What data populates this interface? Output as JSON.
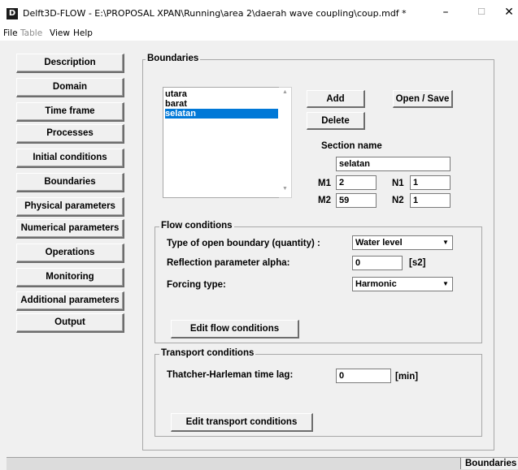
{
  "window": {
    "app_icon_letter": "D",
    "title": "Delft3D-FLOW - E:\\PROPOSAL XPAN\\Running\\area 2\\daerah wave coupling\\coup.mdf *",
    "min_glyph": "–",
    "max_glyph": "☐",
    "close_glyph": "✕"
  },
  "menu": {
    "file": "File",
    "table": "Table",
    "view": "View",
    "help": "Help"
  },
  "nav": {
    "description": "Description",
    "domain": "Domain",
    "time_frame": "Time frame",
    "processes": "Processes",
    "initial_conditions": "Initial conditions",
    "boundaries": "Boundaries",
    "physical_parameters": "Physical parameters",
    "numerical_parameters": "Numerical parameters",
    "operations": "Operations",
    "monitoring": "Monitoring",
    "additional_parameters": "Additional parameters",
    "output": "Output"
  },
  "boundaries": {
    "group_title": "Boundaries",
    "list": [
      "utara",
      "barat",
      "selatan"
    ],
    "selected_index": 2,
    "add_label": "Add",
    "delete_label": "Delete",
    "open_save_label": "Open / Save",
    "section_name_label": "Section name",
    "section_name_value": "selatan",
    "m1_label": "M1",
    "m1_value": "2",
    "n1_label": "N1",
    "n1_value": "1",
    "m2_label": "M2",
    "m2_value": "59",
    "n2_label": "N2",
    "n2_value": "1"
  },
  "flow": {
    "group_title": "Flow conditions",
    "type_label": "Type of open boundary (quantity) :",
    "type_value": "Water level",
    "reflection_label": "Reflection parameter alpha:",
    "reflection_value": "0",
    "reflection_unit": "[s2]",
    "forcing_label": "Forcing type:",
    "forcing_value": "Harmonic",
    "edit_button": "Edit flow conditions"
  },
  "transport": {
    "group_title": "Transport conditions",
    "lag_label": "Thatcher-Harleman time lag:",
    "lag_value": "0",
    "lag_unit": "[min]",
    "edit_button": "Edit transport conditions"
  },
  "status": {
    "current_section": "Boundaries"
  },
  "colors": {
    "selection": "#0078d7",
    "background": "#f0f0f0"
  }
}
